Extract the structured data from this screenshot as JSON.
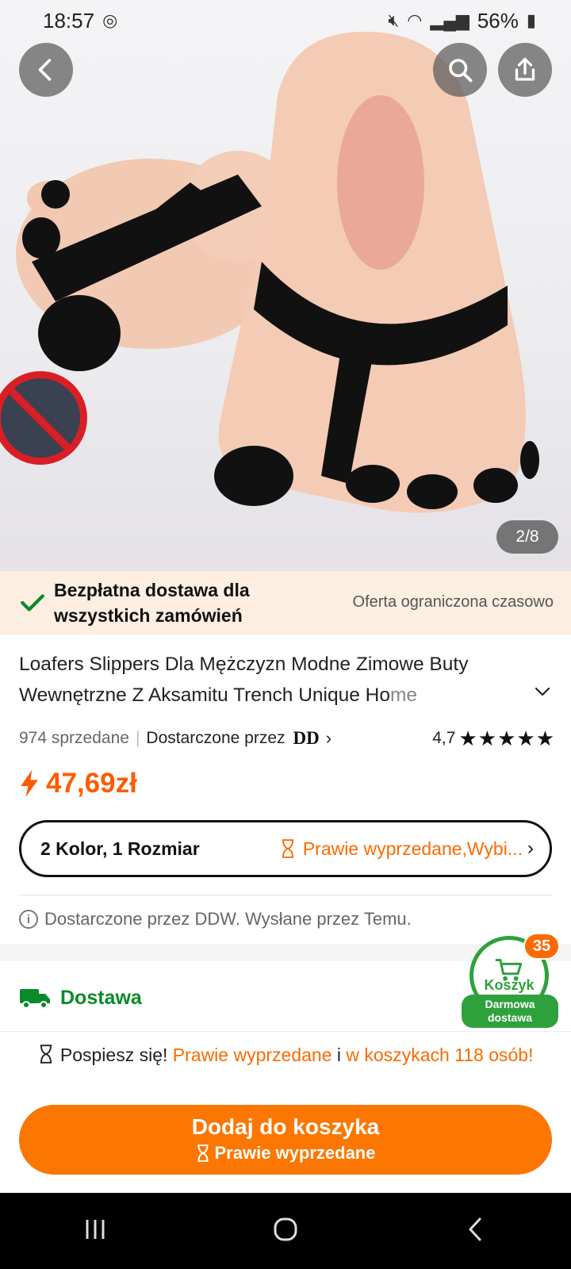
{
  "status": {
    "time": "18:57",
    "battery": "56%"
  },
  "gallery": {
    "counter": "2/8"
  },
  "shipping_banner": {
    "title": "Bezpłatna dostawa dla wszystkich zamówień",
    "offer": "Oferta ograniczona czasowo"
  },
  "product": {
    "title_main": "Loafers Slippers Dla Mężczyzn Modne Zimowe Buty Wewnętrzne Z Aksamitu Trench Unique Ho",
    "title_fade": "me",
    "sold": "974 sprzedane",
    "delivered_by": "Dostarczone przez",
    "seller_logo": "DD",
    "rating": "4,7",
    "stars": "★★★★★",
    "price": "47,69zł"
  },
  "variant": {
    "selection": "2 Kolor, 1 Rozmiar",
    "stock": "Prawie wyprzedane,",
    "more": " Wybi..."
  },
  "fulfilment": "Dostarczone przez DDW. Wysłane przez Temu.",
  "delivery": {
    "label": "Dostawa"
  },
  "cart": {
    "badge": "35",
    "label": "Koszyk",
    "free_line1": "Darmowa",
    "free_line2": "dostawa"
  },
  "hurry": {
    "prefix": "Pospiesz się!",
    "almost": "Prawie wyprzedane",
    "conj": "i",
    "carts": "w koszykach 118 osób!"
  },
  "add_button": {
    "label": "Dodaj do koszyka",
    "sub": "Prawie wyprzedane"
  },
  "colors": {
    "accent": "#fb7701",
    "green": "#2fa13c",
    "price": "#fb5c00"
  }
}
